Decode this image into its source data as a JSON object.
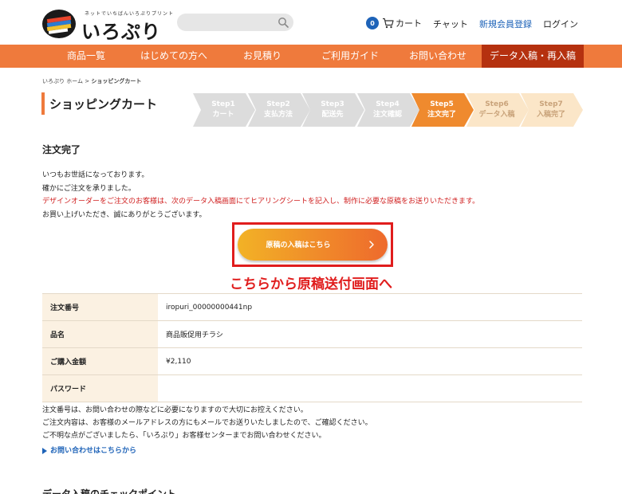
{
  "header": {
    "logo_tagline": "ネットでいちばんいろぷりプリント",
    "logo_text": "いろぷり",
    "search_placeholder": "",
    "cart_count": "0",
    "cart_label": "カート",
    "chat_label": "チャット",
    "register_label": "新規会員登録",
    "login_label": "ログイン"
  },
  "menu": {
    "items": [
      "商品一覧",
      "はじめての方へ",
      "お見積り",
      "ご利用ガイド",
      "お問い合わせ",
      "データ入稿・再入稿"
    ]
  },
  "breadcrumb": {
    "home": "いろぷり ホーム",
    "separator": " > ",
    "current": "ショッピングカート"
  },
  "page_title": "ショッピングカート",
  "steps": [
    {
      "step": "Step1",
      "label": "カート",
      "state": "done"
    },
    {
      "step": "Step2",
      "label": "支払方法",
      "state": "done"
    },
    {
      "step": "Step3",
      "label": "配送先",
      "state": "done"
    },
    {
      "step": "Step4",
      "label": "注文確認",
      "state": "done"
    },
    {
      "step": "Step5",
      "label": "注文完了",
      "state": "current"
    },
    {
      "step": "Step6",
      "label": "データ入稿",
      "state": "todo"
    },
    {
      "step": "Step7",
      "label": "入稿完了",
      "state": "todo"
    }
  ],
  "colors": {
    "brand_orange": "#ef7a3c",
    "active_menu": "#b5310f",
    "step_done": "#dcdcdc",
    "step_current": "#ef8a2e",
    "step_todo": "#fbe6c8",
    "link_blue": "#1e63b8",
    "alert_red": "#e01d1d"
  },
  "content": {
    "heading": "注文完了",
    "messages": [
      "いつもお世話になっております。",
      "確かにご注文を承りました。",
      "デザインオーダーをご注文のお客様は、次のデータ入稿画面にてヒアリングシートを記入し、制作に必要な原稿をお送りいただきます。",
      "お買い上げいただき、誠にありがとうございます。"
    ],
    "upload_button": "原稿の入稿はこちら",
    "callout": "こちらから原稿送付画面へ"
  },
  "order_table": [
    {
      "label": "注文番号",
      "value": "iropuri_00000000441np"
    },
    {
      "label": "品名",
      "value": "商品販促用チラシ"
    },
    {
      "label": "ご購入金額",
      "value": "¥2,110"
    },
    {
      "label": "パスワード",
      "value": ""
    }
  ],
  "notes": [
    "注文番号は、お問い合わせの際などに必要になりますので大切にお控えください。",
    "ご注文内容は、お客様のメールアドレスの方にもメールでお送りいたしましたので、ご確認ください。",
    "ご不明な点がございましたら、「いろぷり」お客様センターまでお問い合わせください。"
  ],
  "contact_link": "お問い合わせはこちらから",
  "next_heading": "データ入稿のチェックポイント"
}
